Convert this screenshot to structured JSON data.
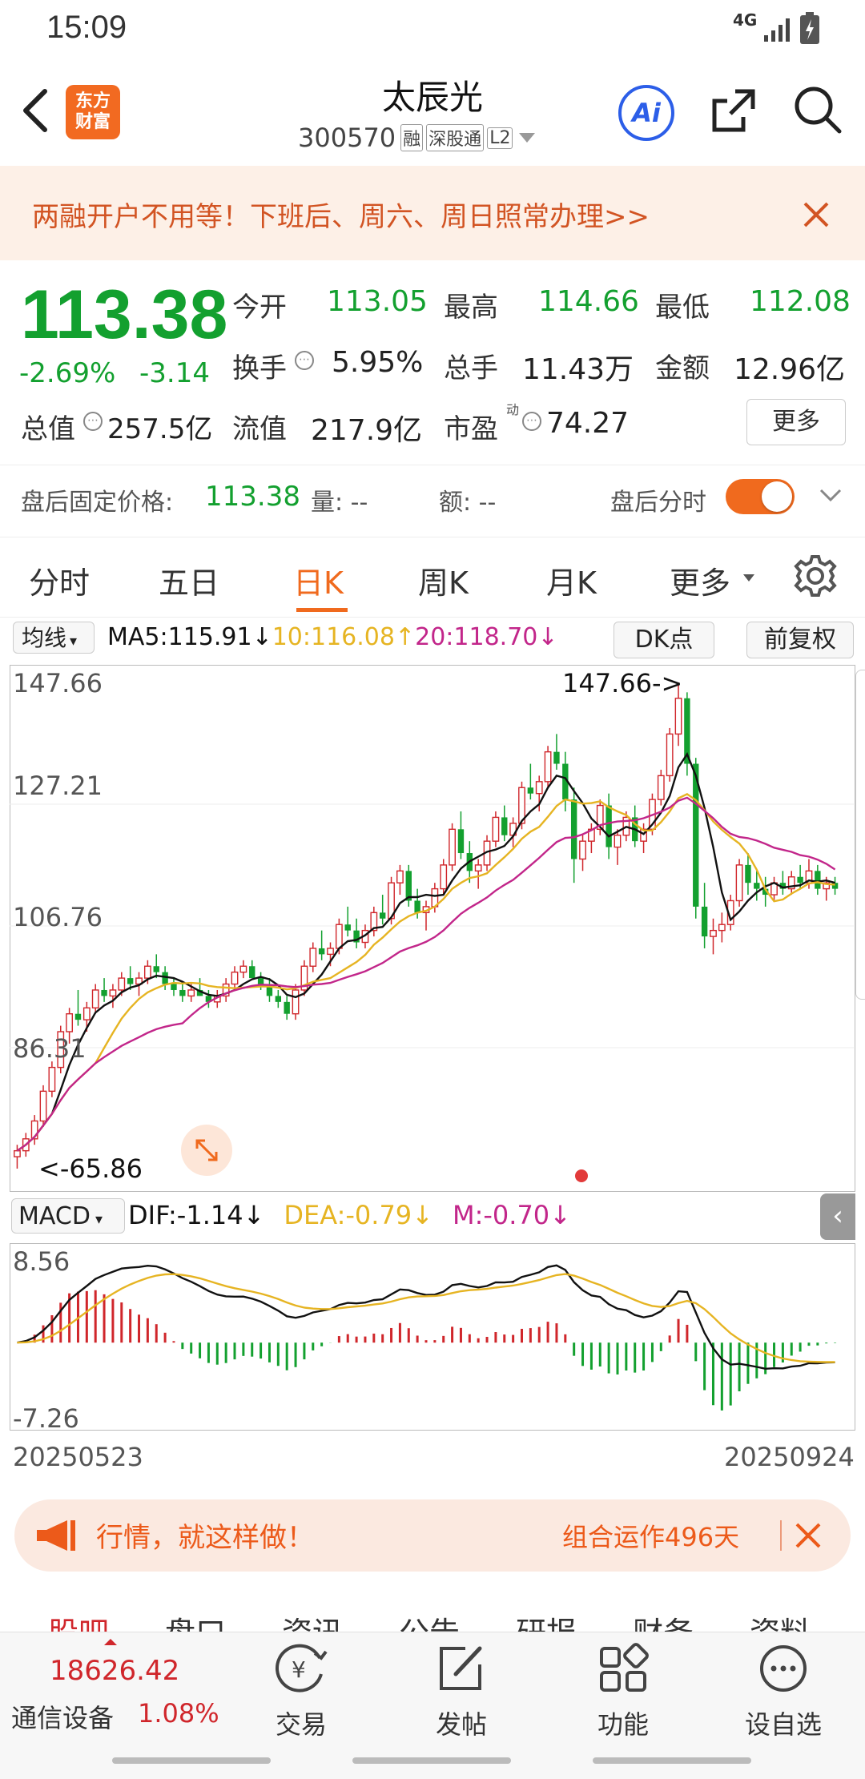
{
  "status": {
    "time": "15:09",
    "network": "4G"
  },
  "header": {
    "title": "太辰光",
    "code": "300570",
    "tags": [
      "融",
      "深股通",
      "L2"
    ],
    "logo_lines": [
      "东方",
      "财富"
    ],
    "ai_label": "Ai"
  },
  "banner": {
    "text": "两融开户不用等！下班后、周六、周日照常办理>>"
  },
  "quote": {
    "price": "113.38",
    "change_pct": "-2.69%",
    "change": "-3.14",
    "open_label": "今开",
    "open": "113.05",
    "high_label": "最高",
    "high": "114.66",
    "low_label": "最低",
    "low": "112.08",
    "turnover_label": "换手",
    "turnover": "5.95%",
    "volume_label": "总手",
    "volume": "11.43万",
    "amount_label": "金额",
    "amount": "12.96亿",
    "mcap_label": "总值",
    "mcap": "257.5亿",
    "float_label": "流值",
    "float": "217.9亿",
    "pe_label": "市盈",
    "pe_sup": "动",
    "pe": "74.27",
    "more_label": "更多"
  },
  "after_hours": {
    "price_label": "盘后固定价格:",
    "price": "113.38",
    "vol_label": "量: --",
    "amt_label": "额: --",
    "toggle_label": "盘后分时",
    "toggle_on": true
  },
  "tabs": [
    "分时",
    "五日",
    "日K",
    "周K",
    "月K",
    "更多"
  ],
  "active_tab": "日K",
  "ma_bar": {
    "select": "均线",
    "ma5": "MA5:115.91",
    "ma5_arrow": "↓",
    "ma10": "10:116.08",
    "ma10_arrow": "↑",
    "ma20": "20:118.70",
    "ma20_arrow": "↓",
    "dk": "DK点",
    "adjust": "前复权"
  },
  "macd_bar": {
    "select": "MACD",
    "dif": "DIF:-1.14",
    "dif_arrow": "↓",
    "dea": "DEA:-0.79",
    "dea_arrow": "↓",
    "m": "M:-0.70",
    "m_arrow": "↓"
  },
  "colors": {
    "up": "#d0262b",
    "down": "#13a02f",
    "ma5": "#111111",
    "ma10": "#e6b422",
    "ma20": "#c2268a",
    "accent": "#f06a1e"
  },
  "chart_data": [
    {
      "type": "candlestick",
      "y_ticks": [
        "147.66",
        "127.21",
        "106.76",
        "86.31"
      ],
      "ylim": [
        65.86,
        147.66
      ],
      "x_start": "20250523",
      "x_end": "20250924",
      "max_annotation": "147.66->",
      "min_annotation": "<-65.86",
      "candles": [
        [
          68,
          70,
          66,
          69
        ],
        [
          69,
          72,
          68,
          71
        ],
        [
          71,
          75,
          70,
          74
        ],
        [
          74,
          80,
          73,
          79
        ],
        [
          79,
          84,
          78,
          83
        ],
        [
          83,
          90,
          82,
          89
        ],
        [
          89,
          93,
          87,
          92
        ],
        [
          92,
          96,
          90,
          91
        ],
        [
          91,
          94,
          89,
          93
        ],
        [
          93,
          97,
          92,
          96
        ],
        [
          96,
          98,
          94,
          95
        ],
        [
          95,
          97,
          93,
          96
        ],
        [
          96,
          99,
          95,
          98
        ],
        [
          98,
          100,
          96,
          97
        ],
        [
          97,
          99,
          95,
          98
        ],
        [
          98,
          101,
          97,
          100
        ],
        [
          100,
          102,
          98,
          99
        ],
        [
          99,
          100,
          96,
          97
        ],
        [
          97,
          98,
          95,
          96
        ],
        [
          96,
          97,
          94,
          95
        ],
        [
          95,
          97,
          94,
          96
        ],
        [
          96,
          98,
          95,
          95
        ],
        [
          95,
          96,
          93,
          94
        ],
        [
          94,
          96,
          93,
          95
        ],
        [
          95,
          98,
          94,
          97
        ],
        [
          97,
          100,
          96,
          99
        ],
        [
          99,
          101,
          98,
          100
        ],
        [
          100,
          101,
          98,
          98
        ],
        [
          98,
          99,
          96,
          97
        ],
        [
          97,
          98,
          94,
          95
        ],
        [
          95,
          96,
          93,
          94
        ],
        [
          94,
          95,
          91,
          92
        ],
        [
          92,
          97,
          91,
          96
        ],
        [
          96,
          101,
          95,
          100
        ],
        [
          100,
          104,
          99,
          103
        ],
        [
          103,
          106,
          101,
          102
        ],
        [
          102,
          104,
          100,
          103
        ],
        [
          103,
          108,
          102,
          107
        ],
        [
          107,
          110,
          105,
          106
        ],
        [
          106,
          108,
          103,
          104
        ],
        [
          104,
          107,
          103,
          106
        ],
        [
          106,
          110,
          105,
          109
        ],
        [
          109,
          112,
          107,
          108
        ],
        [
          108,
          115,
          107,
          114
        ],
        [
          114,
          117,
          112,
          116
        ],
        [
          116,
          117,
          110,
          111
        ],
        [
          111,
          113,
          108,
          109
        ],
        [
          109,
          111,
          106,
          110
        ],
        [
          110,
          114,
          109,
          113
        ],
        [
          113,
          118,
          112,
          117
        ],
        [
          117,
          124,
          116,
          123
        ],
        [
          123,
          126,
          118,
          119
        ],
        [
          119,
          121,
          114,
          116
        ],
        [
          116,
          118,
          113,
          117
        ],
        [
          117,
          122,
          116,
          121
        ],
        [
          121,
          126,
          120,
          125
        ],
        [
          125,
          127,
          121,
          122
        ],
        [
          122,
          125,
          120,
          124
        ],
        [
          124,
          131,
          123,
          130
        ],
        [
          130,
          134,
          128,
          129
        ],
        [
          129,
          132,
          126,
          131
        ],
        [
          131,
          137,
          130,
          136
        ],
        [
          136,
          139,
          133,
          134
        ],
        [
          134,
          136,
          126,
          128
        ],
        [
          128,
          130,
          114,
          118
        ],
        [
          118,
          122,
          116,
          121
        ],
        [
          121,
          124,
          119,
          123
        ],
        [
          123,
          128,
          122,
          127
        ],
        [
          127,
          129,
          118,
          120
        ],
        [
          120,
          123,
          117,
          122
        ],
        [
          122,
          126,
          121,
          125
        ],
        [
          125,
          127,
          120,
          121
        ],
        [
          121,
          124,
          119,
          123
        ],
        [
          123,
          129,
          122,
          128
        ],
        [
          128,
          133,
          127,
          132
        ],
        [
          132,
          140,
          131,
          139
        ],
        [
          139,
          147.66,
          137,
          145
        ],
        [
          145,
          146,
          132,
          134
        ],
        [
          134,
          135,
          108,
          110
        ],
        [
          110,
          114,
          103,
          105
        ],
        [
          105,
          108,
          102,
          106
        ],
        [
          106,
          109,
          104,
          107
        ],
        [
          107,
          112,
          106,
          111
        ],
        [
          111,
          118,
          110,
          117
        ],
        [
          117,
          119,
          112,
          114
        ],
        [
          114,
          116,
          111,
          113
        ],
        [
          113,
          115,
          110,
          112
        ],
        [
          112,
          115,
          111,
          114
        ],
        [
          114,
          116,
          112,
          113
        ],
        [
          113,
          116,
          112,
          115
        ],
        [
          115,
          117,
          113,
          114
        ],
        [
          114,
          118,
          113,
          116
        ],
        [
          116,
          117,
          112,
          113
        ],
        [
          113,
          115,
          111,
          114
        ],
        [
          114,
          115,
          112,
          113
        ]
      ]
    },
    {
      "type": "bar",
      "name": "MACD",
      "y_ticks": [
        "8.56",
        "-7.26"
      ],
      "ylim": [
        -7.26,
        8.56
      ]
    }
  ],
  "market_bar": {
    "text": "行情，就这样做！",
    "right": "组合运作496天"
  },
  "subtabs": [
    "股吧",
    "盘口",
    "资讯",
    "公告",
    "研报",
    "财务",
    "资料"
  ],
  "bottom_nav": {
    "index_value": "18626.42",
    "index_name": "通信设备",
    "index_pct": "1.08%",
    "items": [
      "交易",
      "发帖",
      "功能",
      "设自选"
    ]
  }
}
